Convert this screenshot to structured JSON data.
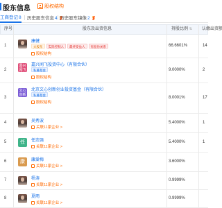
{
  "header": {
    "title": "股东信息",
    "structure_link": "股权结构"
  },
  "tabs": [
    {
      "label": "工商登记",
      "count": "8",
      "active": true
    },
    {
      "label": "历史股东信息",
      "count": "4",
      "active": false,
      "vip": true
    },
    {
      "label": "历史股东镜像",
      "count": "2",
      "active": false,
      "vip": true
    }
  ],
  "table": {
    "headers": {
      "index": "序号",
      "shareholder": "股东及出资信息",
      "ratio": "持股比例",
      "capital": "认缴出资额"
    },
    "rows": [
      {
        "index": "1",
        "name": "康健",
        "avatar": {
          "type": "photo"
        },
        "tags": [
          {
            "text": "大股东",
            "style": "orange"
          },
          {
            "text": "实际控制人",
            "style": "red"
          },
          {
            "text": "最终受益人",
            "style": "red"
          },
          {
            "text": "有股份关系",
            "style": "red"
          }
        ],
        "sub_link": "股权结构",
        "ratio": "66.6601%",
        "capital": "14"
      },
      {
        "index": "2",
        "name": "嘉兴闻飞投资中心（有限合伙）",
        "avatar": {
          "type": "text",
          "text": "嘉兴闻飞投资",
          "color": "#e0507a"
        },
        "tags": [
          {
            "text": "私募基金",
            "style": "blue"
          }
        ],
        "sub_link": "股权结构",
        "ratio": "9.0000%",
        "capital": "2"
      },
      {
        "index": "3",
        "name": "北京文心创新创业投资基金（有限合伙）",
        "avatar": {
          "type": "text",
          "text": "文心创新",
          "color": "#7b5cd6"
        },
        "tags": [
          {
            "text": "私募基金",
            "style": "blue"
          }
        ],
        "sub_link": "股权结构",
        "ratio": "8.0001%",
        "capital": "17"
      },
      {
        "index": "4",
        "name": "吴秀波",
        "avatar": {
          "type": "photo"
        },
        "tags": [],
        "sub_link": "关联11家企业 >",
        "ratio": "5.4000%",
        "capital": "1"
      },
      {
        "index": "5",
        "name": "任志强",
        "avatar": {
          "type": "text",
          "text": "任",
          "color": "#3fb489",
          "single": true
        },
        "tags": [],
        "sub_link": "关联11家企业 >",
        "ratio": "5.4000%",
        "capital": "1"
      },
      {
        "index": "6",
        "name": "康爱梅",
        "avatar": {
          "type": "text",
          "text": "康",
          "color": "#d99a4e",
          "single": true
        },
        "tags": [],
        "sub_link": "关联11家企业 >",
        "ratio": "3.6000%",
        "capital": ""
      },
      {
        "index": "7",
        "name": "杨涛",
        "avatar": {
          "type": "photo"
        },
        "tags": [],
        "sub_link": "关联11家企业 >",
        "ratio": "0.9999%",
        "capital": ""
      },
      {
        "index": "8",
        "name": "夏雨",
        "avatar": {
          "type": "photo"
        },
        "tags": [],
        "sub_link": "关联11家企业 >",
        "ratio": "0.9999%",
        "capital": ""
      }
    ]
  }
}
